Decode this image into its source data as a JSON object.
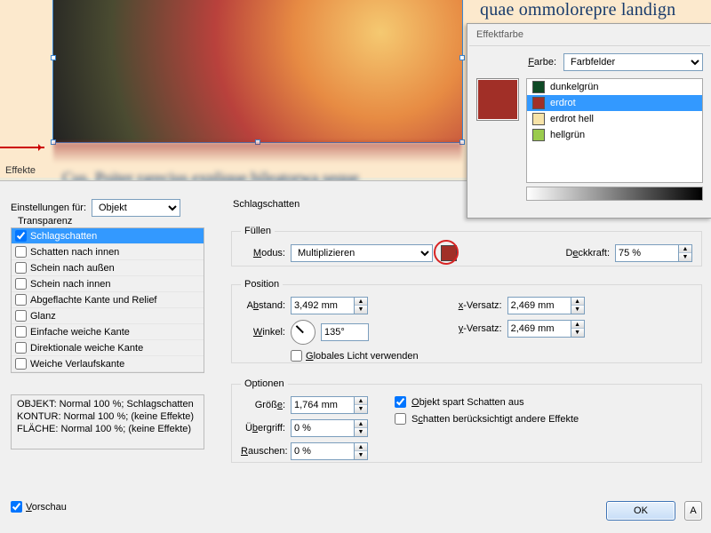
{
  "document": {
    "body_text_top": "quae ommolorepre landign",
    "blur_text": "Cus. Poiter rarecius explique bileatorwa seque"
  },
  "effekte_dialog": {
    "title": "Effekte",
    "settings_label": "Einstellungen für:",
    "settings_value": "Objekt",
    "transparency_group": "Transparenz",
    "effects_list": [
      {
        "label": "Schlagschatten",
        "checked": true,
        "selected": true
      },
      {
        "label": "Schatten nach innen",
        "checked": false
      },
      {
        "label": "Schein nach außen",
        "checked": false
      },
      {
        "label": "Schein nach innen",
        "checked": false
      },
      {
        "label": "Abgeflachte Kante und Relief",
        "checked": false
      },
      {
        "label": "Glanz",
        "checked": false
      },
      {
        "label": "Einfache weiche Kante",
        "checked": false
      },
      {
        "label": "Direktionale weiche Kante",
        "checked": false
      },
      {
        "label": "Weiche Verlaufskante",
        "checked": false
      }
    ],
    "summary": {
      "line1": "OBJEKT: Normal 100 %; Schlagschatten",
      "line2": "KONTUR: Normal 100 %; (keine Effekte)",
      "line3": "FLÄCHE: Normal 100 %; (keine Effekte)"
    },
    "preview_label": "Vorschau",
    "preview_checked": true,
    "section_title": "Schlagschatten",
    "fill_group": {
      "legend": "Füllen",
      "mode_label": "Modus:",
      "mode_value": "Multiplizieren",
      "swatch_color": "#a12f27",
      "opacity_label": "Deckkraft:",
      "opacity_value": "75 %"
    },
    "position_group": {
      "legend": "Position",
      "distance_label": "Abstand:",
      "distance_value": "3,492 mm",
      "angle_label": "Winkel:",
      "angle_value": "135°",
      "global_light_label": "Globales Licht verwenden",
      "global_light_checked": false,
      "x_offset_label": "x-Versatz:",
      "x_offset_value": "2,469 mm",
      "y_offset_label": "y-Versatz:",
      "y_offset_value": "2,469 mm"
    },
    "options_group": {
      "legend": "Optionen",
      "size_label": "Größe:",
      "size_value": "1,764 mm",
      "spread_label": "Übergriff:",
      "spread_value": "0 %",
      "noise_label": "Rauschen:",
      "noise_value": "0 %",
      "knockout_label": "Objekt spart Schatten aus",
      "knockout_checked": true,
      "other_fx_label": "Schatten berücksichtigt andere Effekte",
      "other_fx_checked": false
    },
    "ok_label": "OK",
    "cancel_label": "A"
  },
  "color_panel": {
    "title": "Effektfarbe",
    "color_label": "Farbe:",
    "color_mode": "Farbfelder",
    "big_swatch": "#a12f27",
    "swatches": [
      {
        "label": "dunkelgrün",
        "color": "#0f4a26",
        "selected": false
      },
      {
        "label": "erdrot",
        "color": "#a12f27",
        "selected": true
      },
      {
        "label": "erdrot hell",
        "color": "#f7e3a8",
        "selected": false
      },
      {
        "label": "hellgrün",
        "color": "#9acb4d",
        "selected": false
      }
    ]
  },
  "colors": {
    "selection": "#3399ff"
  }
}
